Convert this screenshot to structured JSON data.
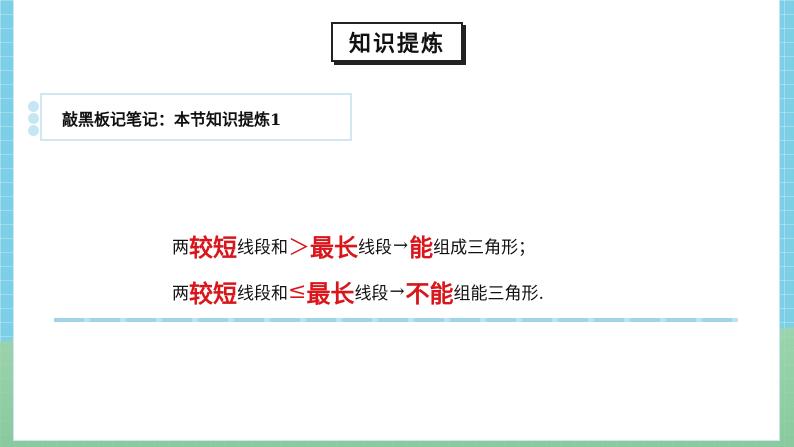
{
  "title": "知识提炼",
  "note": {
    "label": "敲黑板记笔记：本节知识提炼1"
  },
  "rule1": {
    "p1": "两",
    "p2": "较短",
    "p3": "线段和",
    "p4": "＞",
    "p5": "最长",
    "p6": "线段",
    "p7": "→",
    "p8": "能",
    "p9": "组成三角形；"
  },
  "rule2": {
    "p1": "两",
    "p2": "较短",
    "p3": "线段和",
    "p4": "≤",
    "p5": "最长",
    "p6": "线段",
    "p7": "→",
    "p8": "不能",
    "p9": "组能三角形."
  },
  "colors": {
    "accent_red": "#d8161b",
    "frame_blue": "#7ccfe6"
  }
}
